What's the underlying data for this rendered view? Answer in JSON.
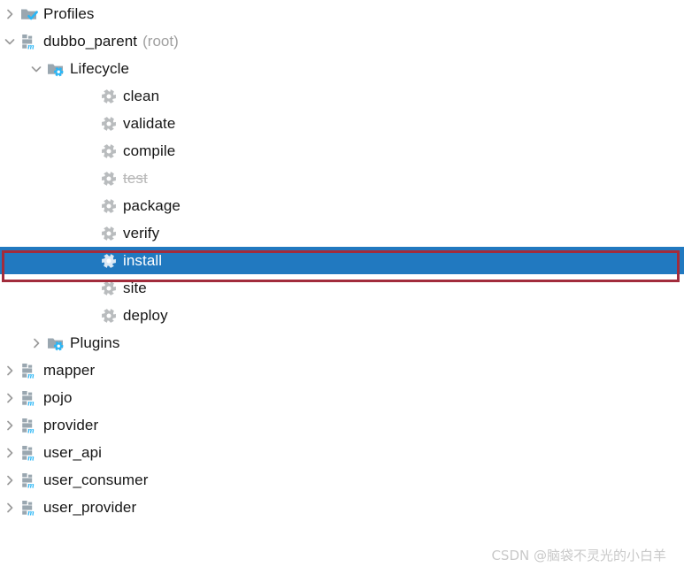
{
  "panel": {
    "name": "maven-projects-tree"
  },
  "colors": {
    "selection_bg": "#2179c0",
    "selection_text": "#ffffff",
    "annotation_border": "#a22c3c",
    "text": "#161616",
    "muted_text": "#a0a0a0",
    "disabled_text": "#b7b7b7",
    "icon_folder": "#9aa7b0",
    "icon_accent": "#29b6f6",
    "icon_gear": "#b9bcbe",
    "watermark": "#c9c9c9"
  },
  "annotation": {
    "target_row": "install",
    "color": "#a22c3c"
  },
  "watermark": {
    "text": "CSDN @脑袋不灵光的小白羊"
  },
  "tree": {
    "rows": [
      {
        "label": "Profiles",
        "suffix": "",
        "indent": 0,
        "twisty": "collapsed",
        "icon": "folder-check-icon",
        "state": "normal"
      },
      {
        "label": "dubbo_parent",
        "suffix": "(root)",
        "indent": 0,
        "twisty": "expanded",
        "icon": "maven-module-icon",
        "state": "normal"
      },
      {
        "label": "Lifecycle",
        "suffix": "",
        "indent": 1,
        "twisty": "expanded",
        "icon": "folder-gear-icon",
        "state": "normal"
      },
      {
        "label": "clean",
        "suffix": "",
        "indent": 3,
        "twisty": "none",
        "icon": "gear-icon",
        "state": "normal"
      },
      {
        "label": "validate",
        "suffix": "",
        "indent": 3,
        "twisty": "none",
        "icon": "gear-icon",
        "state": "normal"
      },
      {
        "label": "compile",
        "suffix": "",
        "indent": 3,
        "twisty": "none",
        "icon": "gear-icon",
        "state": "normal"
      },
      {
        "label": "test",
        "suffix": "",
        "indent": 3,
        "twisty": "none",
        "icon": "gear-icon",
        "state": "disabled"
      },
      {
        "label": "package",
        "suffix": "",
        "indent": 3,
        "twisty": "none",
        "icon": "gear-icon",
        "state": "normal"
      },
      {
        "label": "verify",
        "suffix": "",
        "indent": 3,
        "twisty": "none",
        "icon": "gear-icon",
        "state": "normal"
      },
      {
        "label": "install",
        "suffix": "",
        "indent": 3,
        "twisty": "none",
        "icon": "gear-icon",
        "state": "selected"
      },
      {
        "label": "site",
        "suffix": "",
        "indent": 3,
        "twisty": "none",
        "icon": "gear-icon",
        "state": "normal"
      },
      {
        "label": "deploy",
        "suffix": "",
        "indent": 3,
        "twisty": "none",
        "icon": "gear-icon",
        "state": "normal"
      },
      {
        "label": "Plugins",
        "suffix": "",
        "indent": 1,
        "twisty": "collapsed",
        "icon": "folder-gear-icon",
        "state": "normal"
      },
      {
        "label": "mapper",
        "suffix": "",
        "indent": 0,
        "twisty": "collapsed",
        "icon": "maven-module-icon",
        "state": "normal"
      },
      {
        "label": "pojo",
        "suffix": "",
        "indent": 0,
        "twisty": "collapsed",
        "icon": "maven-module-icon",
        "state": "normal"
      },
      {
        "label": "provider",
        "suffix": "",
        "indent": 0,
        "twisty": "collapsed",
        "icon": "maven-module-icon",
        "state": "normal"
      },
      {
        "label": "user_api",
        "suffix": "",
        "indent": 0,
        "twisty": "collapsed",
        "icon": "maven-module-icon",
        "state": "normal"
      },
      {
        "label": "user_consumer",
        "suffix": "",
        "indent": 0,
        "twisty": "collapsed",
        "icon": "maven-module-icon",
        "state": "normal"
      },
      {
        "label": "user_provider",
        "suffix": "",
        "indent": 0,
        "twisty": "collapsed",
        "icon": "maven-module-icon",
        "state": "normal"
      }
    ]
  }
}
